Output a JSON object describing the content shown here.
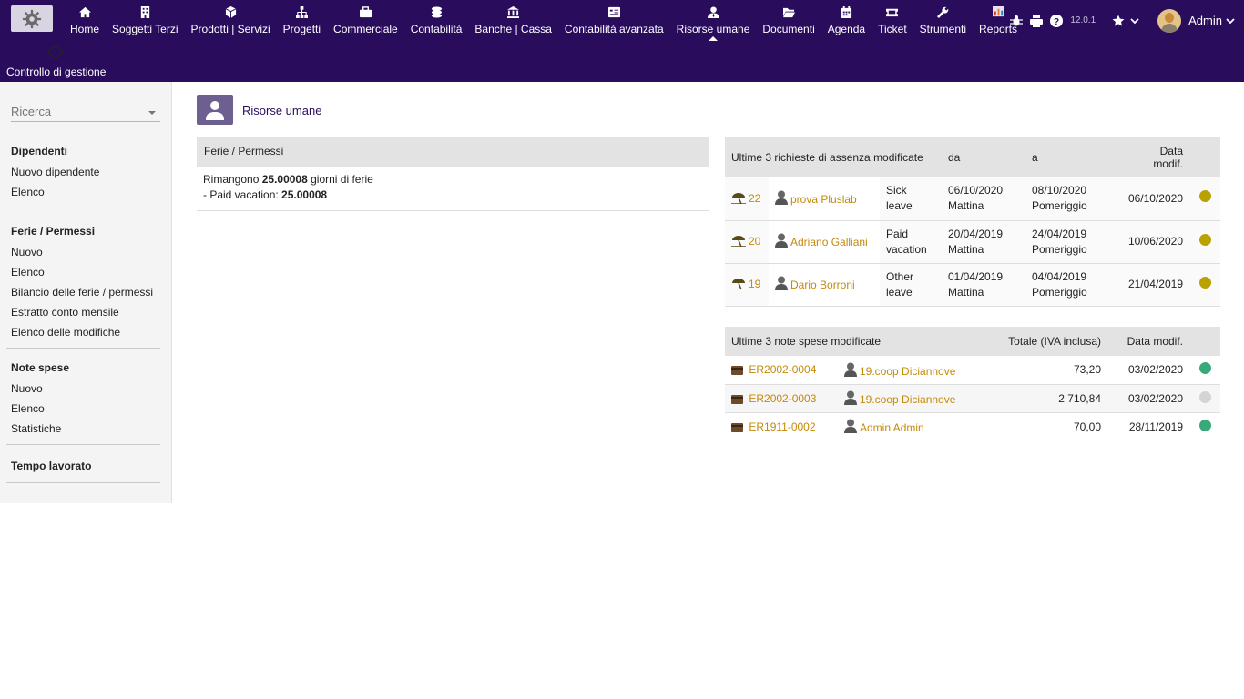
{
  "topbar": {
    "menu": [
      {
        "label": "Home",
        "icon": "home-icon"
      },
      {
        "label": "Soggetti Terzi",
        "icon": "building-icon"
      },
      {
        "label": "Prodotti | Servizi",
        "icon": "cube-icon"
      },
      {
        "label": "Progetti",
        "icon": "sitemap-icon"
      },
      {
        "label": "Commerciale",
        "icon": "briefcase-icon"
      },
      {
        "label": "Contabilità",
        "icon": "coins-icon"
      },
      {
        "label": "Banche | Cassa",
        "icon": "bank-icon"
      },
      {
        "label": "Contabilità avanzata",
        "icon": "ledger-icon"
      },
      {
        "label": "Risorse umane",
        "icon": "user-tie-icon",
        "active": true
      },
      {
        "label": "Documenti",
        "icon": "folder-open-icon"
      },
      {
        "label": "Agenda",
        "icon": "calendar-icon"
      },
      {
        "label": "Ticket",
        "icon": "ticket-icon"
      },
      {
        "label": "Strumenti",
        "icon": "wrench-icon"
      },
      {
        "label": "Reports",
        "icon": "chart-icon"
      }
    ],
    "second_row": {
      "label": "Controllo di gestione",
      "icon": "piggy-bank-icon"
    },
    "version": "12.0.1",
    "user": "Admin"
  },
  "sidebar": {
    "search_placeholder": "Ricerca",
    "sections": [
      {
        "title": "Dipendenti",
        "items": [
          "Nuovo dipendente",
          "Elenco"
        ]
      },
      {
        "title": "Ferie / Permessi",
        "items": [
          "Nuovo",
          "Elenco",
          "Bilancio delle ferie / permessi",
          "Estratto conto mensile",
          "Elenco delle modifiche"
        ]
      },
      {
        "title": "Note spese",
        "items": [
          "Nuovo",
          "Elenco",
          "Statistiche"
        ]
      },
      {
        "title": "Tempo lavorato",
        "items": []
      }
    ]
  },
  "main": {
    "title": "Risorse umane",
    "leave_box": {
      "title": "Ferie / Permessi",
      "line1_prefix": "Rimangono ",
      "line1_value": "25.00008",
      "line1_suffix": " giorni di ferie",
      "line2_prefix": "- Paid vacation: ",
      "line2_value": "25.00008"
    },
    "absences": {
      "headers": [
        "Ultime 3 richieste di assenza modificate",
        "da",
        "a",
        "Data modif."
      ],
      "rows": [
        {
          "id": "22",
          "user": "prova Pluslab",
          "type": "Sick leave",
          "from_date": "06/10/2020",
          "from_part": "Mattina",
          "to_date": "08/10/2020",
          "to_part": "Pomeriggio",
          "modified": "06/10/2020",
          "status_color": "#b9a200"
        },
        {
          "id": "20",
          "user": "Adriano Galliani",
          "type": "Paid vacation",
          "from_date": "20/04/2019",
          "from_part": "Mattina",
          "to_date": "24/04/2019",
          "to_part": "Pomeriggio",
          "modified": "10/06/2020",
          "status_color": "#b9a200"
        },
        {
          "id": "19",
          "user": "Dario Borroni",
          "type": "Other leave",
          "from_date": "01/04/2019",
          "from_part": "Mattina",
          "to_date": "04/04/2019",
          "to_part": "Pomeriggio",
          "modified": "21/04/2019",
          "status_color": "#b9a200"
        }
      ]
    },
    "expenses": {
      "headers": [
        "Ultime 3 note spese modificate",
        "Totale (IVA inclusa)",
        "Data modif."
      ],
      "rows": [
        {
          "ref": "ER2002-0004",
          "user": "19.coop Diciannove",
          "total": "73,20",
          "modified": "03/02/2020",
          "status_color": "#3aa97a"
        },
        {
          "ref": "ER2002-0003",
          "user": "19.coop Diciannove",
          "total": "2 710,84",
          "modified": "03/02/2020",
          "status_color": "#d4d4d4"
        },
        {
          "ref": "ER1911-0002",
          "user": "Admin Admin",
          "total": "70,00",
          "modified": "28/11/2019",
          "status_color": "#3aa97a"
        }
      ]
    }
  }
}
